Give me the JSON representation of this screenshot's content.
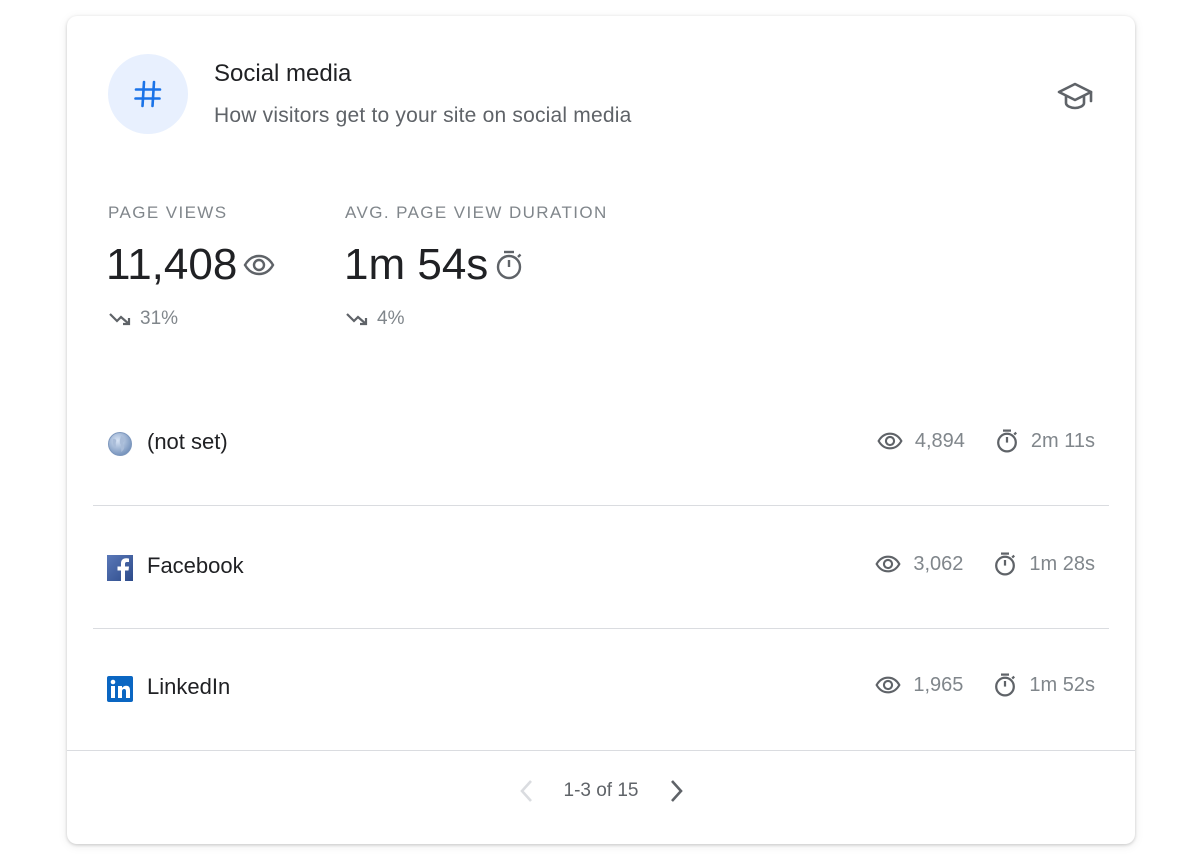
{
  "header": {
    "icon": "hashtag-icon",
    "title": "Social media",
    "subtitle": "How visitors get to your site on social media",
    "learn_icon": "school-icon"
  },
  "metrics": [
    {
      "label": "PAGE VIEWS",
      "value": "11,408",
      "icon": "eye-icon",
      "change": "31%",
      "trend": "down"
    },
    {
      "label": "AVG. PAGE VIEW DURATION",
      "value": "1m 54s",
      "icon": "timer-icon",
      "change": "4%",
      "trend": "down"
    }
  ],
  "rows": [
    {
      "icon": "globe-icon",
      "label": "(not set)",
      "views": "4,894",
      "duration": "2m 11s"
    },
    {
      "icon": "facebook-icon",
      "label": "Facebook",
      "views": "3,062",
      "duration": "1m 28s"
    },
    {
      "icon": "linkedin-icon",
      "label": "LinkedIn",
      "views": "1,965",
      "duration": "1m 52s"
    }
  ],
  "pagination": {
    "text": "1-3 of 15",
    "prev_icon": "chevron-left-icon",
    "next_icon": "chevron-right-icon"
  },
  "colors": {
    "accent": "#1a73e8",
    "icon_bg": "#e8f0fe",
    "muted": "#80868b",
    "text": "#202124",
    "facebook": "#3b5998",
    "linkedin": "#0a66c2"
  }
}
